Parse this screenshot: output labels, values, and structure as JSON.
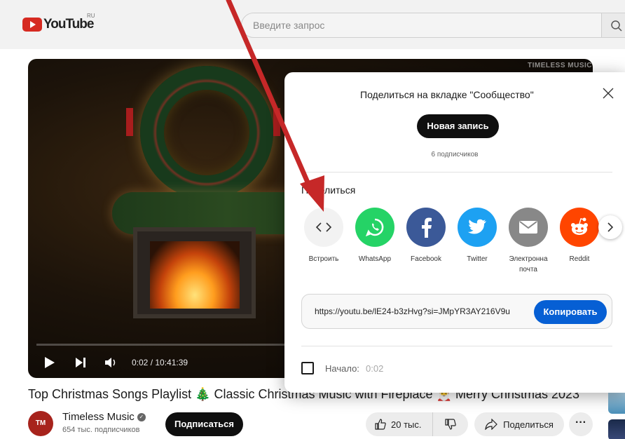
{
  "header": {
    "logo_text": "YouTube",
    "region": "RU",
    "search_placeholder": "Введите запрос"
  },
  "video": {
    "watermark": "TIMELESS MUSIC",
    "time": "0:02 / 10:41:39",
    "progress": 5e-05,
    "title": "Top Christmas Songs Playlist 🎄 Classic Christmas Music with Fireplace 🎅 Merry Christmas 2023"
  },
  "channel": {
    "avatar_text": "TM",
    "name": "Timeless Music",
    "subscribers": "654 тыс. подписчиков",
    "subscribe_label": "Подписаться"
  },
  "actions": {
    "likes": "20 тыс.",
    "share_label": "Поделиться",
    "more_label": "···"
  },
  "dialog": {
    "title": "Поделиться на вкладке \"Сообщество\"",
    "new_post_label": "Новая запись",
    "subscribers": "6 подписчиков",
    "share_section_label": "Поделиться",
    "share_targets": [
      {
        "label": "Встроить",
        "icon": "embed-icon",
        "color": "#f2f2f2"
      },
      {
        "label": "WhatsApp",
        "icon": "whatsapp-icon",
        "color": "#25d366"
      },
      {
        "label": "Facebook",
        "icon": "facebook-icon",
        "color": "#3b5998"
      },
      {
        "label": "Twitter",
        "icon": "twitter-icon",
        "color": "#1da1f2"
      },
      {
        "label": "Электронна почта",
        "icon": "email-icon",
        "color": "#888888"
      },
      {
        "label": "Reddit",
        "icon": "reddit-icon",
        "color": "#ff4500"
      }
    ],
    "url": "https://youtu.be/lE24-b3zHvg?si=JMpYR3AY216V9u",
    "copy_label": "Копировать",
    "start_label": "Начало:",
    "start_time": "0:02"
  },
  "colors": {
    "brand_red": "#ff0000",
    "accent_blue": "#065fd4",
    "annotation_arrow": "#c62828"
  }
}
